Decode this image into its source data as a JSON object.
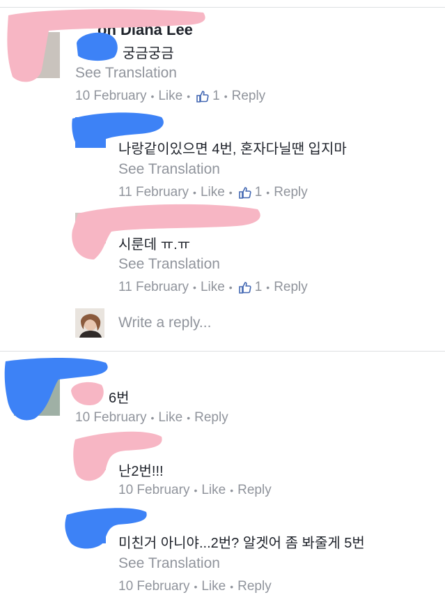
{
  "colors": {
    "redact_pink": "#f7b6c4",
    "redact_blue": "#3d82f6",
    "meta_gray": "#90949c",
    "text": "#1d2129",
    "link_blue": "#4267b2"
  },
  "thread1": {
    "comment": {
      "name_fragment": "on Diana Lee",
      "text": "궁금궁금",
      "see_translation": "See Translation",
      "date": "10 February",
      "like": "Like",
      "like_count": "1",
      "reply": "Reply"
    },
    "replies": [
      {
        "text": "나랑같이있으면 4번, 혼자다닐땐 입지마",
        "see_translation": "See Translation",
        "date": "11 February",
        "like": "Like",
        "like_count": "1",
        "reply": "Reply"
      },
      {
        "text": "시룬데 ㅠ.ㅠ",
        "see_translation": "See Translation",
        "date": "11 February",
        "like": "Like",
        "like_count": "1",
        "reply": "Reply"
      }
    ],
    "write_reply_placeholder": "Write a reply..."
  },
  "thread2": {
    "comment": {
      "text": "6번",
      "date": "10 February",
      "like": "Like",
      "reply": "Reply"
    },
    "replies": [
      {
        "text": "난2번!!!",
        "date": "10 February",
        "like": "Like",
        "reply": "Reply"
      },
      {
        "text": "미친거 아니야...2번? 알겟어 좀 봐줄게 5번",
        "see_translation": "See Translation",
        "date": "10 February",
        "like": "Like",
        "reply": "Reply"
      }
    ]
  },
  "icons": {
    "like": "thumbs-up-icon"
  }
}
